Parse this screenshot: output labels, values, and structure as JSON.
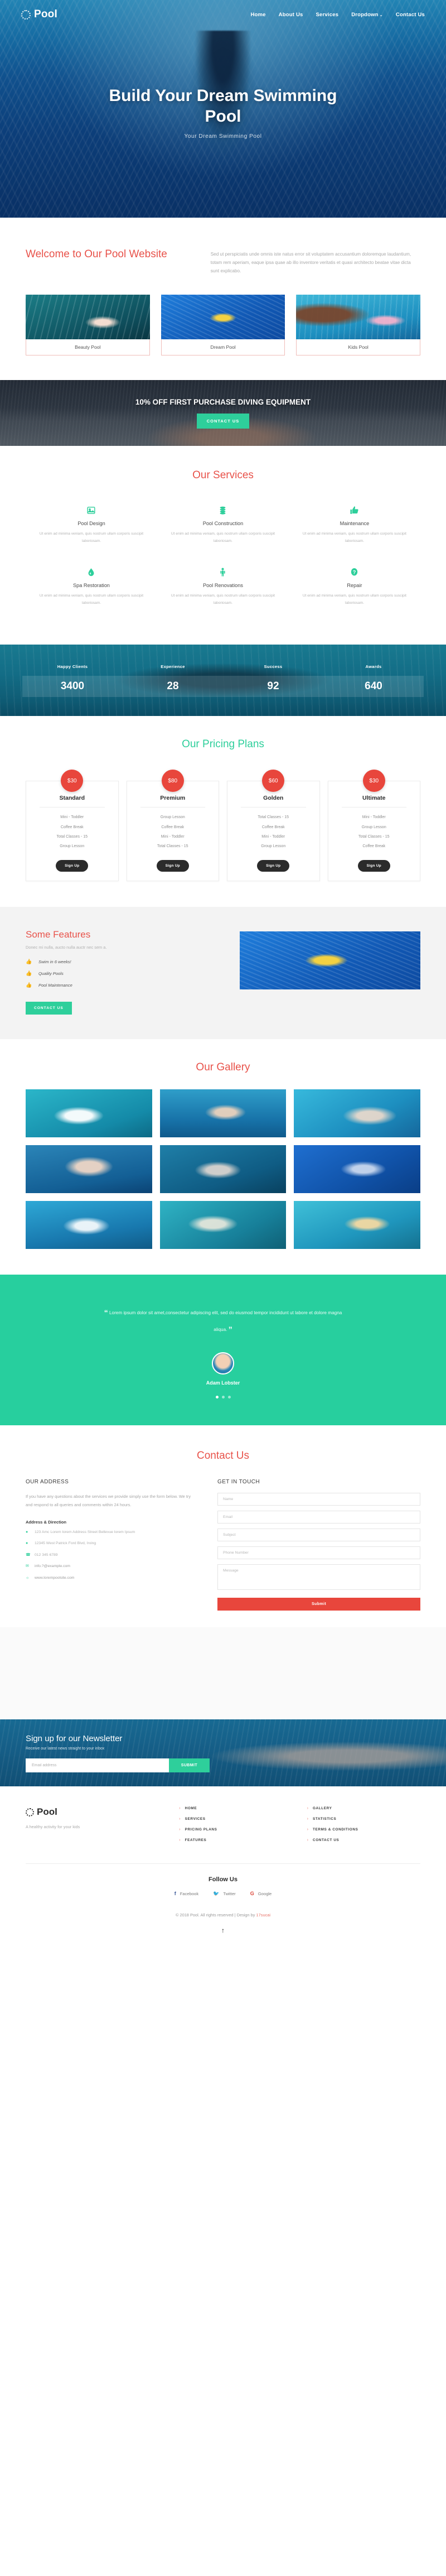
{
  "nav": {
    "brand": "Pool",
    "links": [
      {
        "label": "Home"
      },
      {
        "label": "About Us"
      },
      {
        "label": "Services"
      },
      {
        "label": "Dropdown"
      },
      {
        "label": "Contact Us"
      }
    ],
    "dropdown_caret": "⌄"
  },
  "hero": {
    "title": "Build Your Dream Swimming Pool",
    "subtitle": "Your Dream Swimming Pool"
  },
  "welcome": {
    "heading": "Welcome to Our Pool Website",
    "paragraph": "Sed ut perspiciatis unde omnis iste natus error sit voluptatem accusantium doloremque laudantium, totam rem aperiam, eaque ipsa quae ab illo inventore veritatis et quasi architecto beatae vitae dicta sunt explicabo.",
    "cards": [
      {
        "caption": "Beauty Pool"
      },
      {
        "caption": "Dream Pool"
      },
      {
        "caption": "Kids Pool"
      }
    ]
  },
  "promo": {
    "headline": "10% OFF FIRST PURCHASE DIVING EQUIPMENT",
    "button": "CONTACT US"
  },
  "services": {
    "title": "Our Services",
    "items": [
      {
        "icon": "image-icon",
        "name": "Pool Design",
        "text": "Ut enim ad minima veniam, quis nostrum ullam corporis suscipit laboriosam."
      },
      {
        "icon": "layers-icon",
        "name": "Pool Construction",
        "text": "Ut enim ad minima veniam, quis nostrum ullam corporis suscipit laboriosam."
      },
      {
        "icon": "thumbs-up-icon",
        "name": "Maintenance",
        "text": "Ut enim ad minima veniam, quis nostrum ullam corporis suscipit laboriosam."
      },
      {
        "icon": "water-drop-icon",
        "name": "Spa Restoration",
        "text": "Ut enim ad minima veniam, quis nostrum ullam corporis suscipit laboriosam."
      },
      {
        "icon": "person-icon",
        "name": "Pool Renovations",
        "text": "Ut enim ad minima veniam, quis nostrum ullam corporis suscipit laboriosam."
      },
      {
        "icon": "question-mark-icon",
        "name": "Repair",
        "text": "Ut enim ad minima veniam, quis nostrum ullam corporis suscipit laboriosam."
      }
    ]
  },
  "counters": [
    {
      "label": "Happy Clients",
      "value": "3400"
    },
    {
      "label": "Experience",
      "value": "28"
    },
    {
      "label": "Success",
      "value": "92"
    },
    {
      "label": "Awards",
      "value": "640"
    }
  ],
  "pricing": {
    "title": "Our Pricing Plans",
    "plans": [
      {
        "price": "$30",
        "name": "Standard",
        "features": [
          "Mini - Toddler",
          "Coffee Break",
          "Total Classes - 15",
          "Group Lesson"
        ],
        "button": "Sign Up"
      },
      {
        "price": "$80",
        "name": "Premium",
        "features": [
          "Group Lesson",
          "Coffee Break",
          "Mini - Toddler",
          "Total Classes - 15"
        ],
        "button": "Sign Up"
      },
      {
        "price": "$60",
        "name": "Golden",
        "features": [
          "Total Classes - 15",
          "Coffee Break",
          "Mini - Toddler",
          "Group Lesson"
        ],
        "button": "Sign Up"
      },
      {
        "price": "$30",
        "name": "Ultimate",
        "features": [
          "Mini - Toddler",
          "Group Lesson",
          "Total Classes - 15",
          "Coffee Break"
        ],
        "button": "Sign Up"
      }
    ]
  },
  "features": {
    "heading": "Some Features",
    "subtitle": "Donec mi nulla, aucto nulla auctr nec sem a.",
    "items": [
      {
        "icon": "thumbs-up-icon",
        "label": "Swim in 6 weeks!"
      },
      {
        "icon": "thumbs-up-icon",
        "label": "Quality Pools"
      },
      {
        "icon": "thumbs-up-icon",
        "label": "Pool Maintenance"
      }
    ],
    "button": "CONTACT US"
  },
  "gallery": {
    "title": "Our Gallery"
  },
  "testimonial": {
    "quote": "Lorem ipsum dolor sit amet,consectetur adipiscing elit, sed do eiusmod tempor incididunt ut labore et dolore magna aliqua.",
    "open_quote": "“",
    "close_quote": "”",
    "author": "Adam Lobster"
  },
  "contact": {
    "title": "Contact Us",
    "address_heading": "OUR ADDRESS",
    "address_paragraph": "If you have any questions about the services we provide simply use the form below. We try and respond to all queries and comments within 24 hours.",
    "address_sub": "Address & Direction",
    "address_line": "123 Amc Lorem lorem Address Street Bellevue lorem Ipsum",
    "details": [
      {
        "icon": "map-pin-icon",
        "text": "12345 West Patrick Ford Blvd, Irving"
      },
      {
        "icon": "phone-icon",
        "text": "012 345 6789"
      },
      {
        "icon": "mail-icon",
        "text": "info.?@example.com"
      },
      {
        "icon": "globe-icon",
        "text": "www.lorempoolsite.com"
      }
    ],
    "form_heading": "GET IN TOUCH",
    "fields": [
      {
        "placeholder": "Name"
      },
      {
        "placeholder": "Email"
      },
      {
        "placeholder": "Subject"
      },
      {
        "placeholder": "Phone Number"
      },
      {
        "placeholder": "Message"
      }
    ],
    "submit": "Submit"
  },
  "newsletter": {
    "heading": "Sign up for our Newsletter",
    "subtext": "Receive our latest news straight to your inbox",
    "placeholder": "Email address",
    "button": "SUBMIT"
  },
  "footer": {
    "brand": "Pool",
    "tagline": "A healthy activity for your kids",
    "col1": [
      {
        "label": "HOME"
      },
      {
        "label": "SERVICES"
      },
      {
        "label": "PRICING PLANS"
      },
      {
        "label": "FEATURES"
      }
    ],
    "col2": [
      {
        "label": "GALLERY"
      },
      {
        "label": "STATISTICS"
      },
      {
        "label": "TERMS & CONDITIONS"
      },
      {
        "label": "CONTACT US"
      }
    ],
    "follow_heading": "Follow Us",
    "socials": [
      {
        "icon": "facebook-icon",
        "glyph": "f",
        "label": "Facebook",
        "color": "#3b5998"
      },
      {
        "icon": "twitter-icon",
        "glyph": "ᵥ",
        "label": "Twitter",
        "color": "#2aa3ef"
      },
      {
        "icon": "google-icon",
        "glyph": "G",
        "label": "Google",
        "color": "#db4437"
      }
    ],
    "copyright_prefix": "© 2018 Pool. All rights reserved | Design by ",
    "designer": "17sucai",
    "to_top": "↑"
  },
  "colors": {
    "accent_red": "#e8524a",
    "accent_teal": "#2ecf9b",
    "dark": "#2b2b2b"
  }
}
